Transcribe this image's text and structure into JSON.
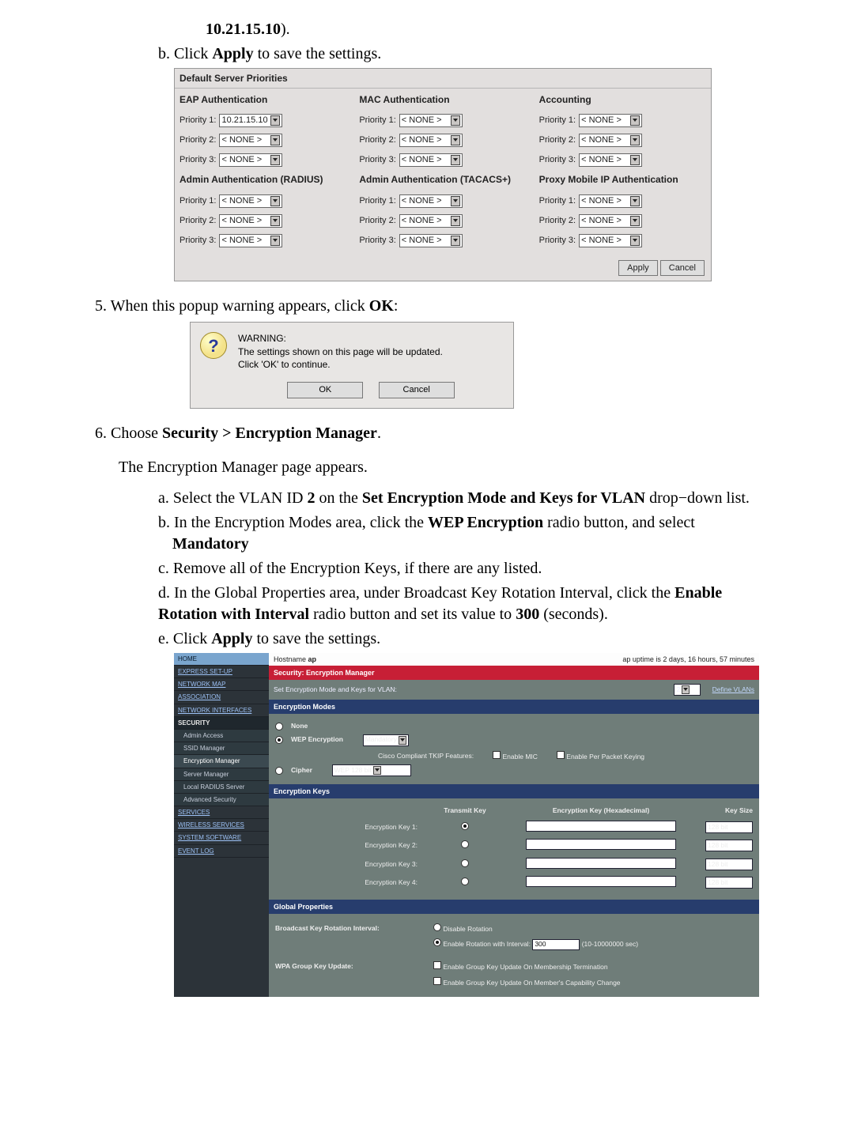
{
  "intro": {
    "ip_frag": "10.21.15.10",
    "ip_tail": ").",
    "step_b": {
      "click": "b. Click ",
      "bold": "Apply",
      "rest": " to save the settings."
    }
  },
  "panel1": {
    "title": "Default Server Priorities",
    "none": "< NONE >",
    "cols": {
      "eap": "EAP Authentication",
      "mac": "MAC Authentication",
      "acct": "Accounting",
      "admin_radius": "Admin Authentication (RADIUS)",
      "admin_tacacs": "Admin Authentication (TACACS+)",
      "proxy": "Proxy Mobile IP Authentication"
    },
    "pri_labels": {
      "p1": "Priority 1:",
      "p2": "Priority 2:",
      "p3": "Priority 3:"
    },
    "eap_p1_value": "10.21.15.10",
    "apply": "Apply",
    "cancel": "Cancel"
  },
  "step5": {
    "pre": "5. When this popup warning appears, click ",
    "bold": "OK",
    "post": ":"
  },
  "warning": {
    "heading": "WARNING:",
    "line1": "The settings shown on this page will be updated.",
    "line2": "Click 'OK' to continue.",
    "ok": "OK",
    "cancel": "Cancel",
    "glyph": "?"
  },
  "step6": {
    "pre": "6. Choose ",
    "bold": "Security > Encryption Manager",
    "post": ".",
    "line2": "The Encryption Manager page appears.",
    "a": {
      "pre": "a. Select the VLAN ID ",
      "bold1": "2",
      "mid": " on the ",
      "bold2": "Set Encryption Mode and Keys for VLAN",
      "post": " drop−down list."
    },
    "b": {
      "pre": "b. In the Encryption Modes area, click the ",
      "bold1": "WEP Encryption",
      "mid": " radio button, and select ",
      "bold2": "Mandatory",
      "post": "."
    },
    "c": "c. Remove all of the Encryption Keys, if there are any listed.",
    "d": {
      "pre": "d. In the Global Properties area, under Broadcast Key Rotation Interval, click the ",
      "bold1": "Enable Rotation with Interval",
      "mid": " radio button and set its value to ",
      "bold2": "300",
      "post": " (seconds)."
    },
    "e": {
      "pre": "e. Click ",
      "bold": "Apply",
      "post": " to save the settings."
    }
  },
  "em": {
    "hostname_label": "Hostname",
    "hostname_value": "ap",
    "uptime": "ap uptime is 2 days, 16 hours, 57 minutes",
    "sidebar": {
      "home": "HOME",
      "express": "EXPRESS SET-UP",
      "netmap": "NETWORK MAP",
      "assoc": "ASSOCIATION",
      "netif": "NETWORK INTERFACES",
      "security": "SECURITY",
      "admin": "Admin Access",
      "ssid": "SSID Manager",
      "encmgr": "Encryption Manager",
      "srvmgr": "Server Manager",
      "localradius": "Local RADIUS Server",
      "advsec": "Advanced Security",
      "services": "SERVICES",
      "wireless": "WIRELESS SERVICES",
      "sysw": "SYSTEM SOFTWARE",
      "evt": "EVENT LOG"
    },
    "red_band": "Security: Encryption Manager",
    "vlan_row": {
      "label": "Set Encryption Mode and Keys for VLAN:",
      "link": "Define VLANs"
    },
    "modes": {
      "band": "Encryption Modes",
      "none": "None",
      "wep": "WEP Encryption",
      "mandatory": "Mandatory",
      "cisco": "Cisco Compliant TKIP Features:",
      "enable_mic": "Enable MIC",
      "ppk": "Enable Per Packet Keying",
      "cipher": "Cipher",
      "cipher_val": "WEP 128 bit"
    },
    "keys": {
      "band": "Encryption Keys",
      "tx": "Transmit Key",
      "hex": "Encryption Key (Hexadecimal)",
      "size": "Key Size",
      "r1": "Encryption Key 1:",
      "r2": "Encryption Key 2:",
      "r3": "Encryption Key 3:",
      "r4": "Encryption Key 4:",
      "ks": "128 bit"
    },
    "gp": {
      "band": "Global Properties",
      "bk_label": "Broadcast Key Rotation Interval:",
      "disable": "Disable Rotation",
      "enable_pre": "Enable Rotation with Interval:",
      "interval": "300",
      "range": "(10-10000000 sec)",
      "wpa_label": "WPA Group Key Update:",
      "wpa1": "Enable Group Key Update On Membership Termination",
      "wpa2": "Enable Group Key Update On Member's Capability Change"
    }
  }
}
